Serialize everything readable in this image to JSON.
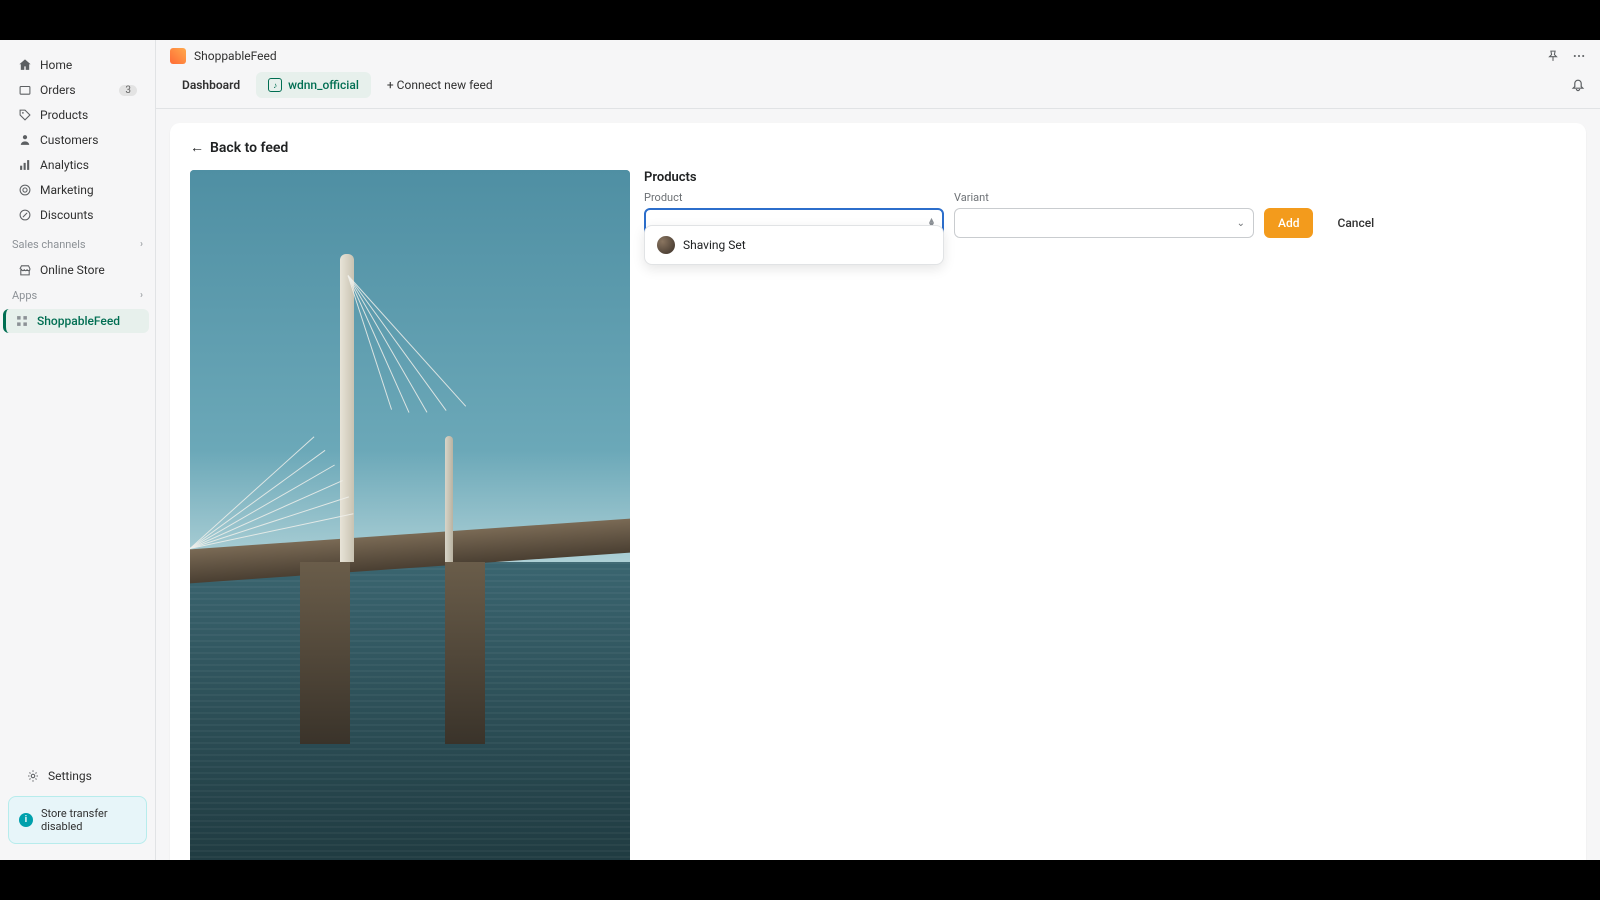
{
  "sidebar": {
    "items": [
      {
        "label": "Home"
      },
      {
        "label": "Orders",
        "badge": "3"
      },
      {
        "label": "Products"
      },
      {
        "label": "Customers"
      },
      {
        "label": "Analytics"
      },
      {
        "label": "Marketing"
      },
      {
        "label": "Discounts"
      }
    ],
    "sales_channels_label": "Sales channels",
    "sales_channels": [
      {
        "label": "Online Store"
      }
    ],
    "apps_label": "Apps",
    "apps": [
      {
        "label": "ShoppableFeed"
      }
    ],
    "settings_label": "Settings",
    "notice": "Store transfer disabled"
  },
  "header": {
    "app_name": "ShoppableFeed"
  },
  "tabs": {
    "dashboard": "Dashboard",
    "feed_name": "wdnn_official",
    "connect": "+ Connect new feed"
  },
  "content": {
    "back_label": "Back to feed",
    "products_title": "Products",
    "product_label": "Product",
    "variant_label": "Variant",
    "add_label": "Add",
    "cancel_label": "Cancel",
    "dropdown_option": "Shaving Set"
  }
}
